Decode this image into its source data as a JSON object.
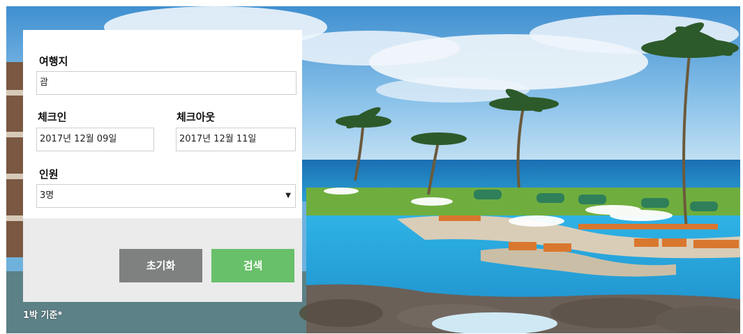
{
  "search_form": {
    "destination_label": "여행지",
    "destination_value": "괌",
    "checkin_label": "체크인",
    "checkin_value": "2017년 12월 09일",
    "checkout_label": "체크아웃",
    "checkout_value": "2017년 12월 11일",
    "guests_label": "인원",
    "guests_value": "3명",
    "reset_label": "초기화",
    "search_label": "검색"
  },
  "footnote": "1박 기준*",
  "colors": {
    "reset_button": "#7f8180",
    "search_button": "#68c06a",
    "panel_bottom": "#ebebeb"
  }
}
